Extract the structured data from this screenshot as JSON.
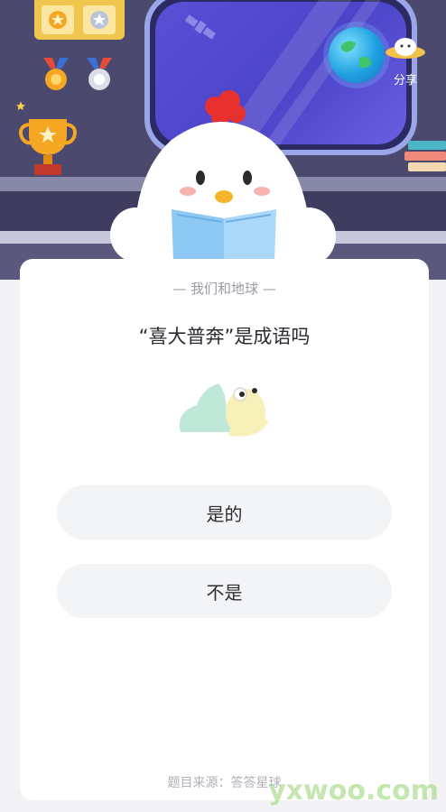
{
  "header": {
    "share_label": "分享"
  },
  "card": {
    "subtitle": "— 我们和地球 —",
    "question": "“喜大普奔”是成语吗",
    "options": [
      {
        "label": "是的"
      },
      {
        "label": "不是"
      }
    ],
    "footer": "题目来源：答答星球"
  },
  "watermark": "yxwoo.com",
  "colors": {
    "header_bg": "#4b4a6e",
    "window_glass": "#4b44c9",
    "card_bg": "#ffffff",
    "option_bg": "#f3f4f6",
    "accent_red": "#e8302e"
  },
  "icons": [
    "trophy-icon",
    "medal-icon",
    "satellite-icon",
    "earth-icon",
    "ufo-icon",
    "books-icon",
    "chicken-mascot",
    "snail-icon"
  ]
}
